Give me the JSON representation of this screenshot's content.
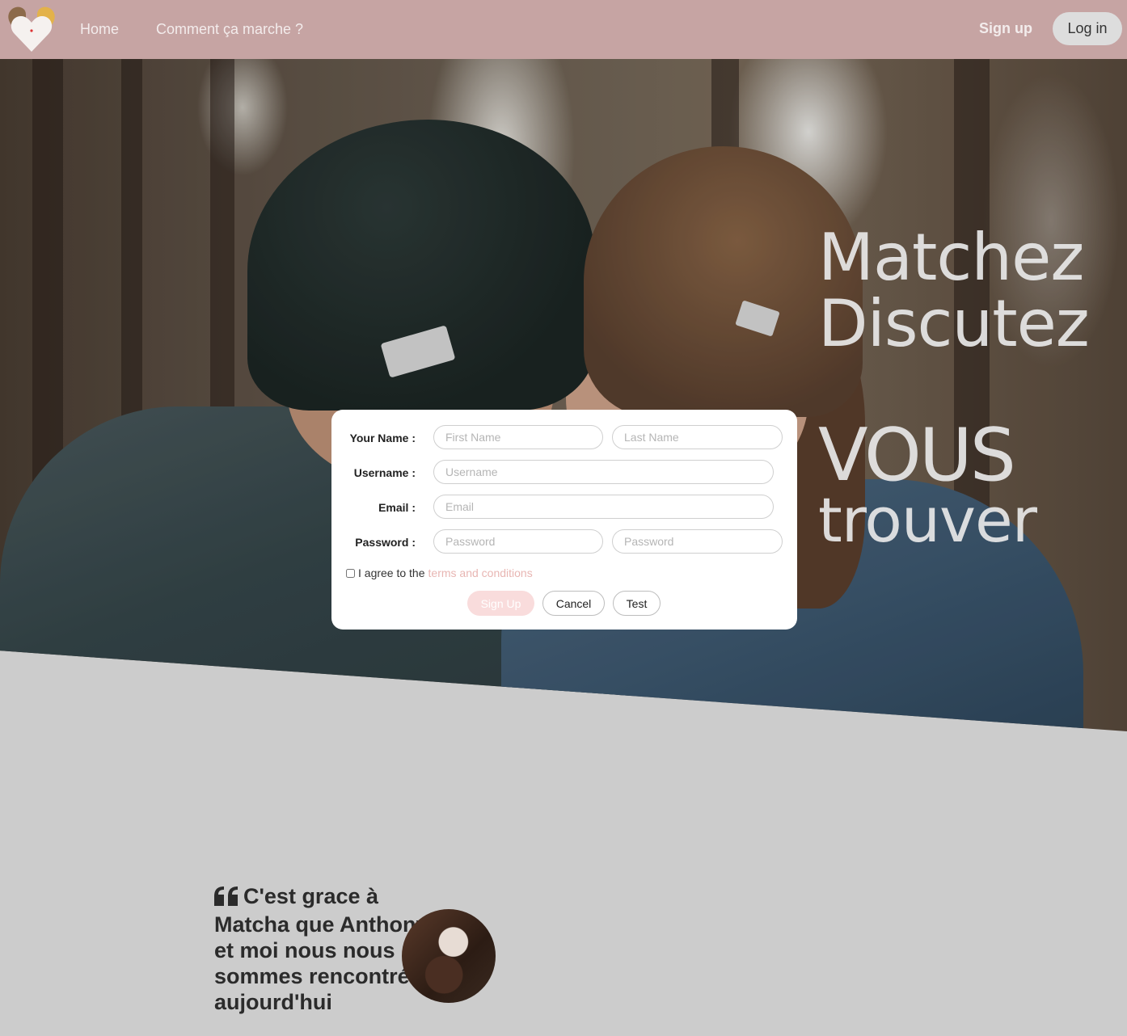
{
  "nav": {
    "home": "Home",
    "how": "Comment ça marche ?",
    "signup": "Sign up",
    "login": "Log in"
  },
  "hero": {
    "line1": "Matchez",
    "line2": "Discutez",
    "line3": "VOUS",
    "line4": "trouver"
  },
  "form": {
    "name_label": "Your Name :",
    "first_name_placeholder": "First Name",
    "last_name_placeholder": "Last Name",
    "username_label": "Username :",
    "username_placeholder": "Username",
    "email_label": "Email :",
    "email_placeholder": "Email",
    "password_label": "Password :",
    "password_placeholder": "Password",
    "password_confirm_placeholder": "Password",
    "terms_text": "I agree to the",
    "terms_link": "terms and conditions",
    "signup_button": "Sign Up",
    "cancel_button": "Cancel",
    "test_button": "Test"
  },
  "testimonial": {
    "quote": "C'est grace à Matcha que Anthony et moi nous nous sommes rencontrés, aujourd'hui"
  },
  "colors": {
    "navbar": "#c6a4a3",
    "accent": "#e8b6b3",
    "background": "#cccccc"
  }
}
